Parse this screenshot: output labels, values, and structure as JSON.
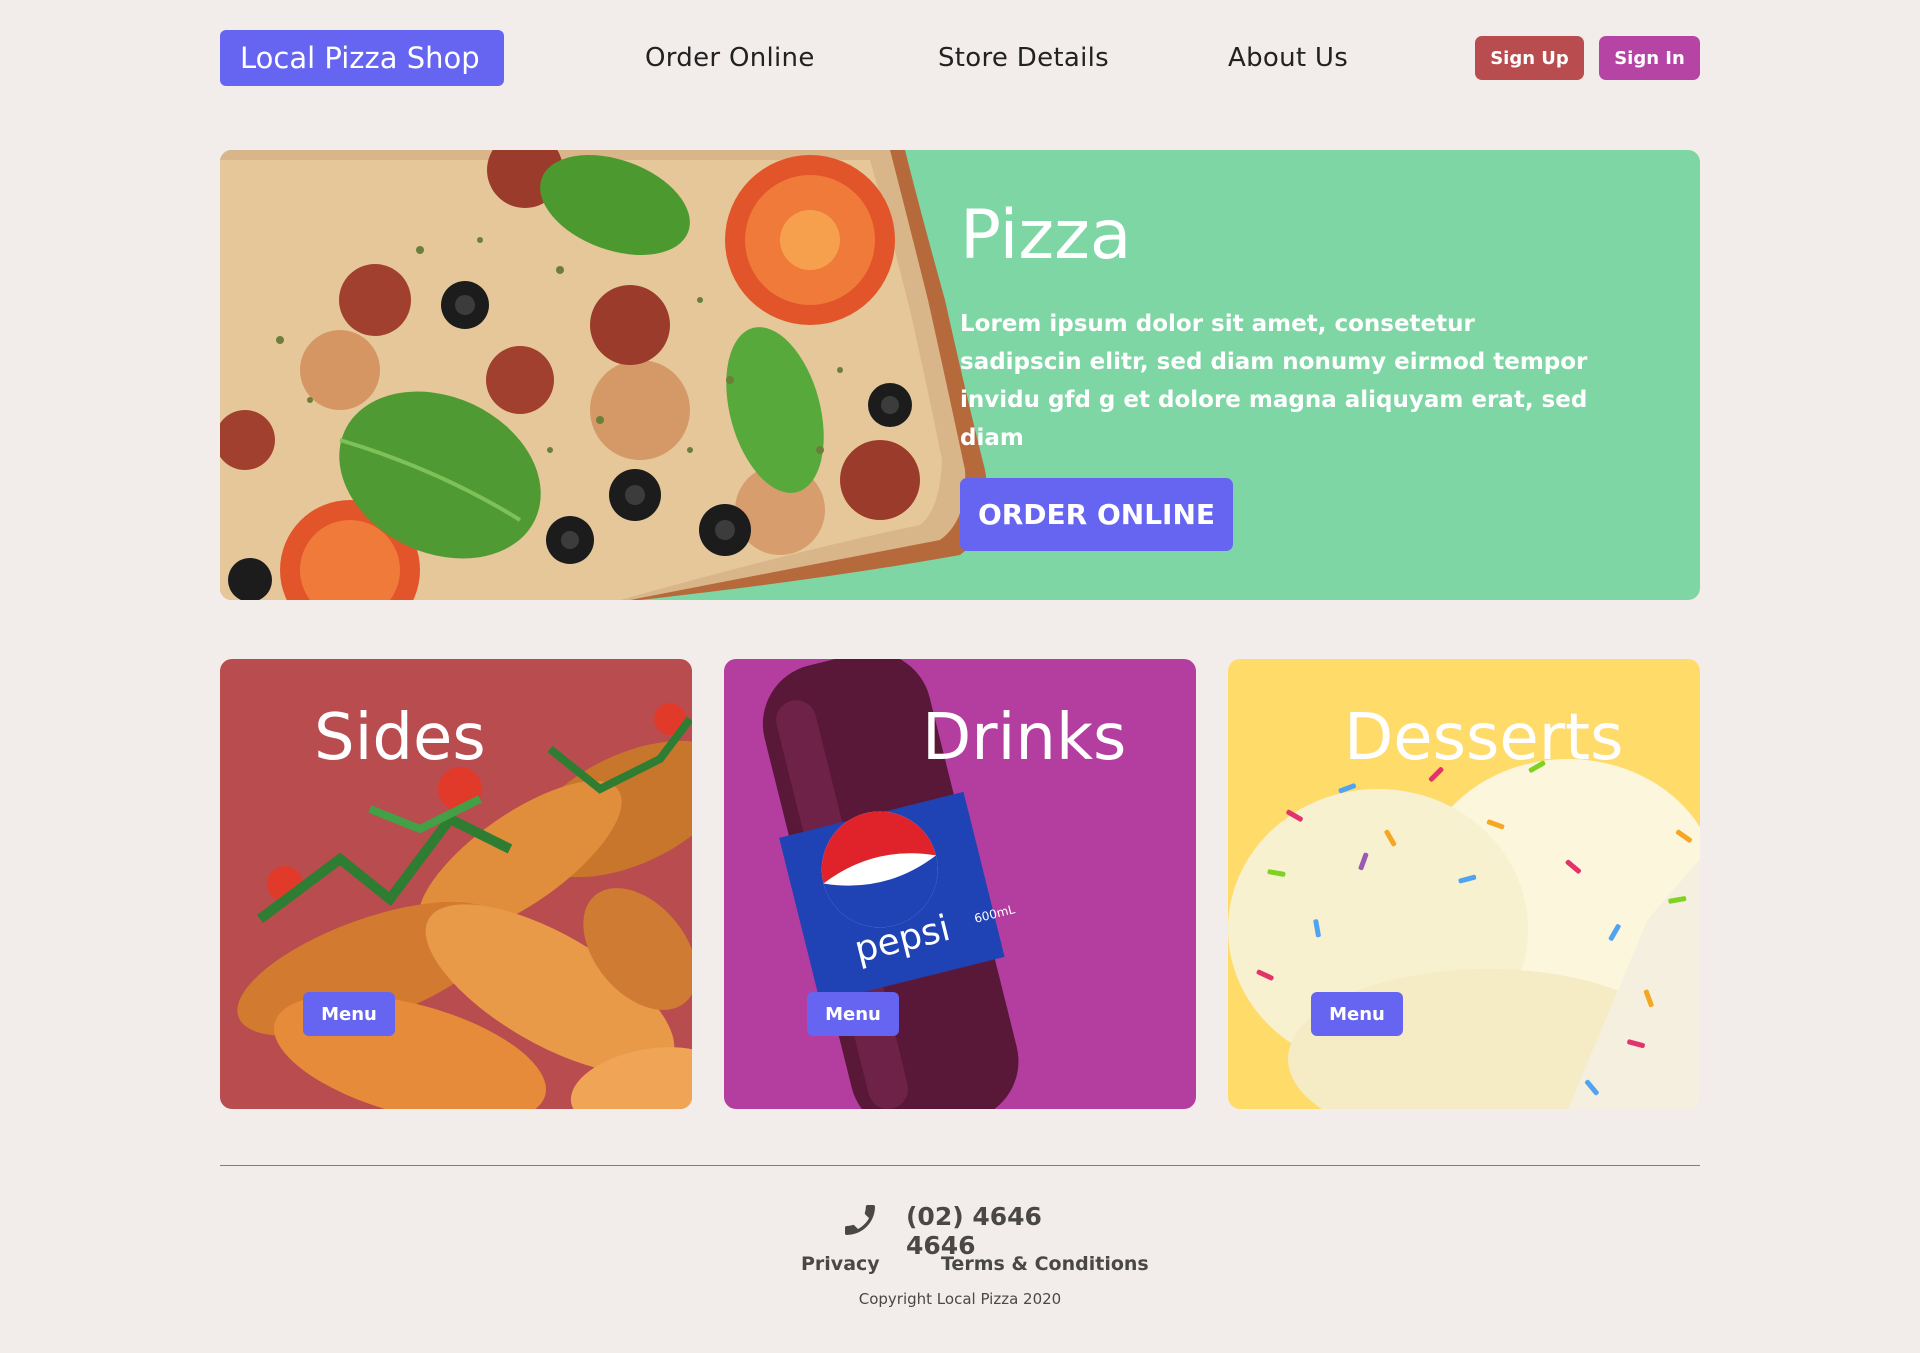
{
  "header": {
    "logo": "Local Pizza Shop",
    "nav": [
      "Order Online",
      "Store Details",
      "About Us"
    ],
    "sign_up": "Sign Up",
    "sign_in": "Sign In"
  },
  "hero": {
    "title": "Pizza",
    "text": "Lorem ipsum dolor sit amet, consetetur sadipscin elitr, sed diam nonumy eirmod tempor invidu gfd g et dolore magna aliquyam erat, sed diam",
    "cta": "ORDER ONLINE"
  },
  "cards": [
    {
      "title": "Sides",
      "button": "Menu",
      "color": "#b84c4f"
    },
    {
      "title": "Drinks",
      "button": "Menu",
      "color": "#b43ea0"
    },
    {
      "title": "Desserts",
      "button": "Menu",
      "color": "#ffdb6a"
    }
  ],
  "drinks_bottle": {
    "brand": "pepsi",
    "size": "600mL"
  },
  "footer": {
    "phone": "(02) 4646 4646",
    "links": [
      "Privacy",
      "Terms & Conditions"
    ],
    "copyright": "Copyright Local Pizza 2020"
  },
  "colors": {
    "background": "#f2edeb",
    "accent": "#6665f1",
    "hero": "#7ed6a5",
    "divider": "#b55aa3"
  },
  "icons": {
    "phone": "phone-icon"
  }
}
